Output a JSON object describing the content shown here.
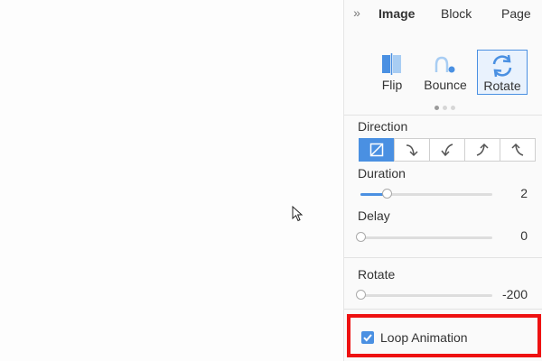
{
  "tabs": {
    "image": "Image",
    "block": "Block",
    "page": "Page"
  },
  "animations": {
    "items": [
      {
        "label": "Flip",
        "icon": "flip-icon"
      },
      {
        "label": "Bounce",
        "icon": "bounce-icon"
      },
      {
        "label": "Rotate",
        "icon": "rotate-icon"
      }
    ],
    "selected": "Rotate",
    "carousel_page": "1 of 3"
  },
  "direction": {
    "label": "Direction",
    "options": [
      "diagonal-icon",
      "curve-down-right-icon",
      "curve-down-left-icon",
      "curve-up-right-icon",
      "curve-up-left-icon"
    ],
    "selected_index": 0
  },
  "duration": {
    "label": "Duration",
    "value": "2",
    "fraction": 0.2
  },
  "delay": {
    "label": "Delay",
    "value": "0",
    "fraction": 0.0
  },
  "rotate": {
    "label": "Rotate",
    "value": "-200",
    "fraction": 0.0
  },
  "loop": {
    "label": "Loop Animation",
    "checked": true
  },
  "colors": {
    "accent": "#4a90e2",
    "highlight": "#ee1111"
  }
}
